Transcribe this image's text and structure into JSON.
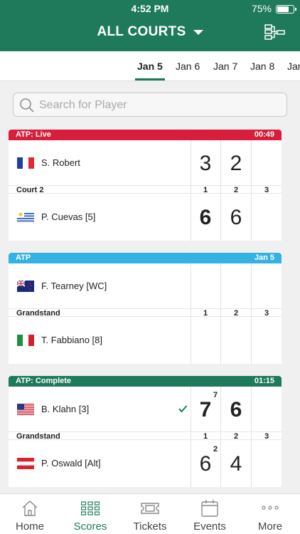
{
  "status": {
    "time": "4:52 PM",
    "battery": "75%",
    "battery_level": 0.75
  },
  "header": {
    "title": "ALL COURTS"
  },
  "dates": {
    "tabs": [
      "Jan 5",
      "Jan 6",
      "Jan 7",
      "Jan 8",
      "Jan"
    ],
    "selected": "Jan 5"
  },
  "search": {
    "placeholder": "Search for Player",
    "value": ""
  },
  "matches": [
    {
      "header_left": "ATP: Live",
      "header_right": "00:49",
      "header_color": "#d81e3a",
      "court": "Court 2",
      "set_headers": [
        "1",
        "2",
        "3"
      ],
      "player1": {
        "name": "S. Robert",
        "flag": "france-flag",
        "scores": [
          "3",
          "2",
          ""
        ]
      },
      "player2": {
        "name": "P. Cuevas [5]",
        "flag": "uruguay-flag",
        "scores": [
          "6",
          "6",
          ""
        ]
      }
    },
    {
      "header_left": "ATP",
      "header_right": "Jan 5",
      "header_color": "#34b3e0",
      "court": "Grandstand",
      "set_headers": [
        "1",
        "2",
        "3"
      ],
      "player1": {
        "name": "F. Tearney [WC]",
        "flag": "new-zealand-flag",
        "scores": [
          "",
          "",
          ""
        ]
      },
      "player2": {
        "name": "T. Fabbiano [8]",
        "flag": "italy-flag",
        "scores": [
          "",
          "",
          ""
        ]
      }
    },
    {
      "header_left": "ATP: Complete",
      "header_right": "01:15",
      "header_color": "#1e7a5a",
      "court": "Grandstand",
      "set_headers": [
        "1",
        "2",
        "3"
      ],
      "player1": {
        "name": "B. Klahn [3]",
        "flag": "usa-flag",
        "scores": [
          "7",
          "6",
          ""
        ],
        "tiebreak": "7",
        "winner": true
      },
      "player2": {
        "name": "P. Oswald [Alt]",
        "flag": "austria-flag",
        "scores": [
          "6",
          "4",
          ""
        ],
        "tiebreak": "2"
      }
    }
  ],
  "nav": {
    "items": [
      {
        "label": "Home",
        "icon": "home-icon"
      },
      {
        "label": "Scores",
        "icon": "scores-grid-icon"
      },
      {
        "label": "Tickets",
        "icon": "ticket-icon"
      },
      {
        "label": "Events",
        "icon": "calendar-icon"
      },
      {
        "label": "More",
        "icon": "more-dots-icon"
      }
    ],
    "active": "Scores"
  },
  "colors": {
    "brand": "#1e7a5a",
    "live": "#d81e3a",
    "scheduled": "#34b3e0"
  }
}
